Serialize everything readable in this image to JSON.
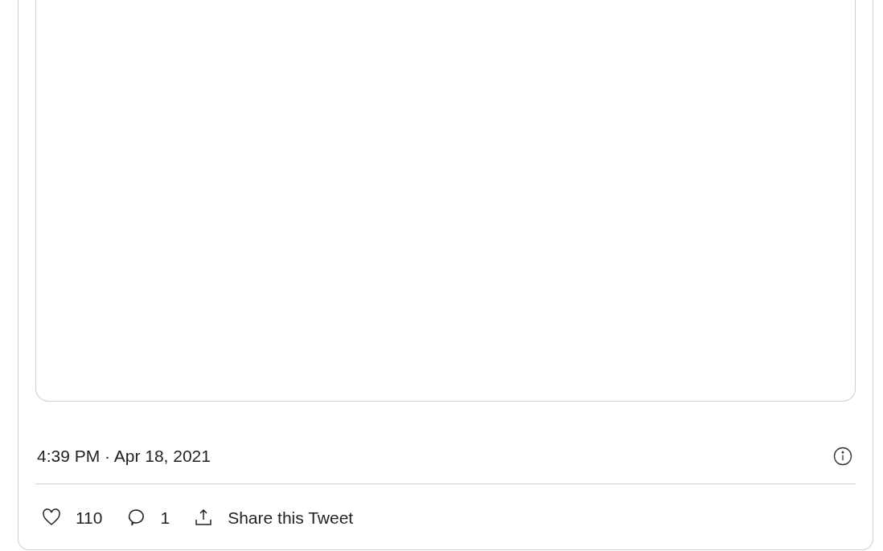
{
  "tweet": {
    "timestamp": "4:39 PM · Apr 18, 2021",
    "actions": [
      {
        "kind": "like",
        "label": "110"
      },
      {
        "kind": "reply",
        "label": "1"
      },
      {
        "kind": "share",
        "label": "Share this Tweet"
      }
    ]
  }
}
